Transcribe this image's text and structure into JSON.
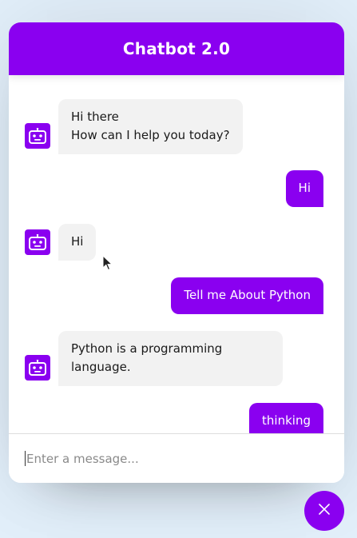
{
  "header": {
    "title": "Chatbot 2.0"
  },
  "messages": [
    {
      "role": "incoming",
      "text": "Hi there\nHow can I help you today?",
      "icon": "robot-icon"
    },
    {
      "role": "outgoing",
      "text": "Hi"
    },
    {
      "role": "incoming",
      "text": "Hi",
      "icon": "robot-icon"
    },
    {
      "role": "outgoing",
      "text": "Tell me About Python"
    },
    {
      "role": "incoming",
      "text": "Python is a programming language.",
      "icon": "robot-icon"
    },
    {
      "role": "outgoing",
      "text": "thinking"
    }
  ],
  "input": {
    "placeholder": "Enter a message..."
  },
  "toggler": {
    "icon": "close-icon"
  },
  "colors": {
    "accent": "#8a00f0",
    "incoming_bg": "#f2f2f2",
    "page_bg": "#e3f0fb"
  }
}
